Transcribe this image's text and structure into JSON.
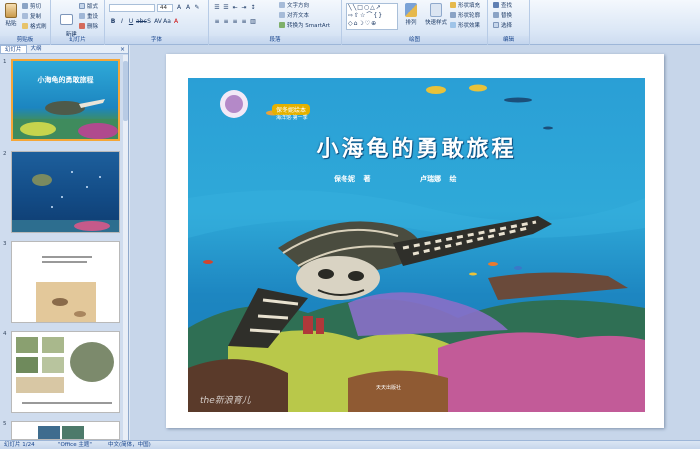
{
  "ribbon": {
    "clipboard": {
      "label": "剪贴板",
      "paste": "粘贴",
      "cut": "剪切",
      "copy": "复制",
      "format_painter": "格式刷"
    },
    "slides": {
      "label": "幻灯片",
      "new_slide": "新建\n幻灯片",
      "layout": "版式",
      "reset": "重设",
      "delete": "删除"
    },
    "font": {
      "label": "字体",
      "font_name": "",
      "font_size": "44"
    },
    "paragraph": {
      "label": "段落",
      "text_direction": "文字方向",
      "align_text": "对齐文本",
      "smartart": "转换为 SmartArt"
    },
    "drawing": {
      "label": "绘图",
      "arrange": "排列",
      "quick_styles": "快速样式",
      "shape_fill": "形状填充",
      "shape_outline": "形状轮廓",
      "shape_effects": "形状效果"
    },
    "editing": {
      "label": "编辑",
      "find": "查找",
      "replace": "替换",
      "select": "选择"
    }
  },
  "pane": {
    "tab_slides": "幻灯片",
    "tab_outline": "大纲",
    "close": "×",
    "slides": [
      {
        "num": "1",
        "selected": true
      },
      {
        "num": "2",
        "selected": false
      },
      {
        "num": "3",
        "selected": false
      },
      {
        "num": "4",
        "selected": false
      },
      {
        "num": "5",
        "selected": false
      }
    ]
  },
  "slide": {
    "title": "小海龟的勇敢旅程",
    "author": "保冬妮",
    "author_role": "著",
    "illustrator": "卢瑞娜",
    "illustrator_role": "绘",
    "series": "保冬妮绘本",
    "series_sub": "海洋馆·第一季",
    "publisher": "天天出版社",
    "watermark": "the新浪育儿",
    "thumb_title": "小海龟的勇敢旅程"
  },
  "status": {
    "slide_info": "幻灯片 1/24",
    "theme": "\"Office 主题\"",
    "language": "中文(简体，中国)"
  },
  "colors": {
    "accent": "#15428b",
    "selection": "#f5a637",
    "ocean": "#2a9fd6"
  }
}
